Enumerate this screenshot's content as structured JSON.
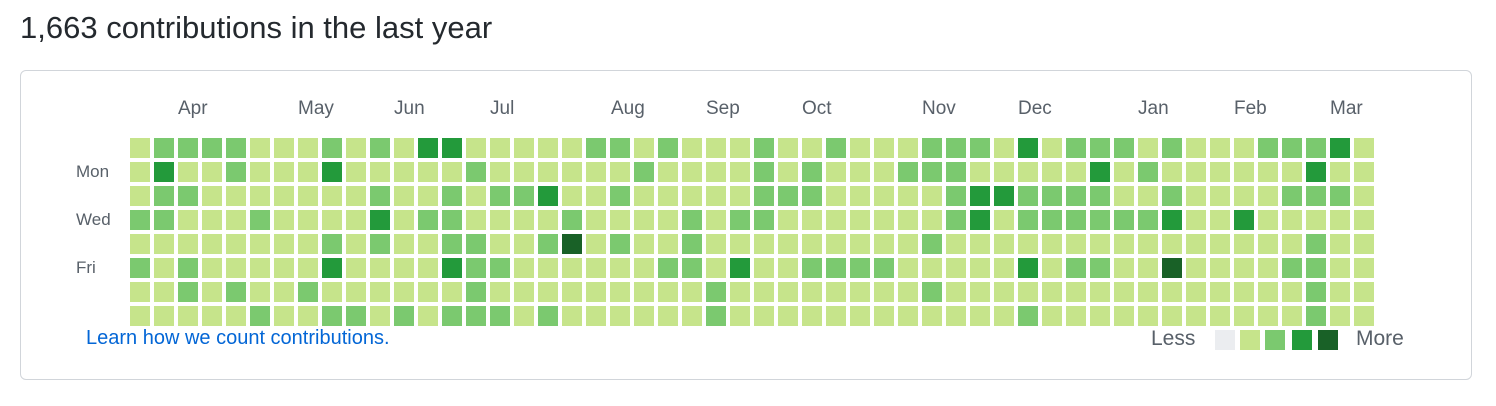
{
  "header": {
    "title": "1,663 contributions in the last year"
  },
  "calendar": {
    "months": [
      "Apr",
      "May",
      "Jun",
      "Jul",
      "Aug",
      "Sep",
      "Oct",
      "Nov",
      "Dec",
      "Jan",
      "Feb",
      "Mar"
    ],
    "day_labels": [
      "Mon",
      "Wed",
      "Fri"
    ],
    "colors": [
      "#ebedf0",
      "#c6e48b",
      "#7bc96f",
      "#239a3b",
      "#196127"
    ],
    "grid": [
      "1222211121213311111221211121121112221312221211122231",
      "1311211131111121111112111121211122211111312111111311",
      "1221111111211212231121111122211111233222211211112221",
      "2211121111312211112111121221111111231222222311311111",
      "1111111121211221124121121111111112111111111111111211",
      "2121111131111322111111221311222211111312211411112211",
      "1121211211111121111111112111111112111111111111111211",
      "1111121122121222121111112111111111111211111111111211"
    ],
    "legend": {
      "less": "Less",
      "more": "More"
    }
  },
  "footer": {
    "link_text": "Learn how we count contributions."
  }
}
